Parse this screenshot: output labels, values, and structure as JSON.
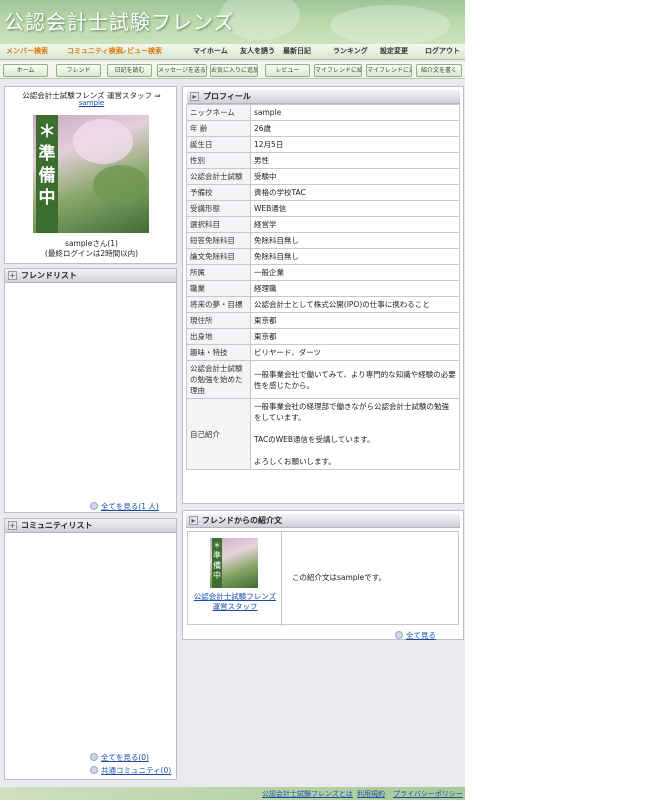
{
  "header": {
    "title": "公認会計士試験フレンズ"
  },
  "nav1": [
    "メンバー検索",
    "コミュニティ検索",
    "レビュー検索",
    "マイホーム",
    "友人を誘う",
    "最新日記",
    "ランキング",
    "設定変更",
    "ログアウト"
  ],
  "nav2": [
    "ホーム",
    "フレンド",
    "日記を読む",
    "メッセージを送る",
    "お気に入りに追加",
    "レビュー",
    "マイフレンドに紹介",
    "マイフレンドに追加",
    "紹介文を書く"
  ],
  "member": {
    "staff_line": "公認会計士試験フレンズ 運営スタッフ ⇒",
    "staff_link": "sample",
    "photo_text": "＊準備中",
    "name_line": "sampleさん(1)",
    "last_login": "(最終ログインは2時間以内)"
  },
  "friend_list": {
    "title": "フレンドリスト",
    "see_all": "全てを見る(1 人)"
  },
  "community_list": {
    "title": "コミュニティリスト",
    "see_all": "全てを見る(0)",
    "common": "共通コミュニティ(0)"
  },
  "profile": {
    "title": "プロフィール",
    "rows": [
      {
        "k": "ニックネーム",
        "v": "sample"
      },
      {
        "k": "年 齢",
        "v": "26歳"
      },
      {
        "k": "誕生日",
        "v": "12月5日"
      },
      {
        "k": "性別",
        "v": "男性"
      },
      {
        "k": "公認会計士試験",
        "v": "受験中"
      },
      {
        "k": "予備校",
        "v": "資格の学校TAC"
      },
      {
        "k": "受講形態",
        "v": "WEB通信"
      },
      {
        "k": "選択科目",
        "v": "経営学"
      },
      {
        "k": "短答免除科目",
        "v": "免除科目無し"
      },
      {
        "k": "論文免除科目",
        "v": "免除科目無し"
      },
      {
        "k": "所属",
        "v": "一般企業"
      },
      {
        "k": "職業",
        "v": "経理職"
      },
      {
        "k": "将来の夢・目標",
        "v": "公認会計士として株式公開(IPO)の仕事に携わること"
      },
      {
        "k": "現住所",
        "v": "東京都"
      },
      {
        "k": "出身地",
        "v": "東京都"
      },
      {
        "k": "趣味・特技",
        "v": "ビリヤード、ダーツ"
      },
      {
        "k": "公認会計士試験の勉強を始めた理由",
        "v": "一般事業会社で働いてみて、より専門的な知識や経験の必要性を感じたから。"
      },
      {
        "k": "自己紹介",
        "v": "一般事業会社の経理部で働きながら公認会計士試験の勉強をしています。\n\nTACのWEB通信を受講しています。\n\nよろしくお願いします。"
      }
    ]
  },
  "intro": {
    "title": "フレンドからの紹介文",
    "author": "公認会計士試験フレンズ運営スタッフ",
    "text": "この紹介文はsampleです。",
    "see_all": "全て見る"
  },
  "footer": [
    "公認会計士試験フレンズとは",
    "利用規約",
    "プライバシーポリシー"
  ]
}
